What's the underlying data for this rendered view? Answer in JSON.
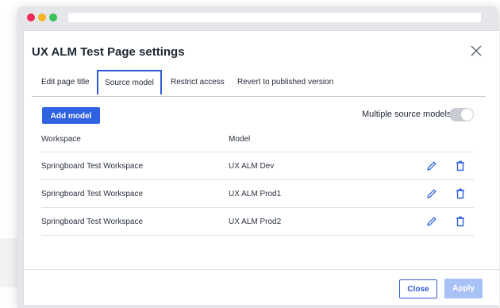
{
  "dialog": {
    "title": "UX ALM Test Page settings"
  },
  "tabs": [
    {
      "label": "Edit page title",
      "active": false
    },
    {
      "label": "Source model",
      "active": true
    },
    {
      "label": "Restrict access",
      "active": false
    },
    {
      "label": "Revert to published version",
      "active": false
    }
  ],
  "toolbar": {
    "add_model_label": "Add model",
    "multiple_source_label": "Multiple source models",
    "multiple_source_enabled": false
  },
  "table": {
    "columns": [
      "Workspace",
      "Model"
    ],
    "rows": [
      {
        "workspace": "Springboard Test Workspace",
        "model": "UX ALM Dev"
      },
      {
        "workspace": "Springboard Test Workspace",
        "model": "UX ALM Prod1"
      },
      {
        "workspace": "Springboard Test Workspace",
        "model": "UX ALM Prod2"
      }
    ]
  },
  "footer": {
    "close_label": "Close",
    "apply_label": "Apply",
    "apply_enabled": false
  },
  "colors": {
    "accent": "#2f62e0",
    "apply_disabled": "#a9c2f5"
  },
  "icons": {
    "close": "close-icon",
    "edit": "pencil-icon",
    "delete": "trash-icon"
  }
}
